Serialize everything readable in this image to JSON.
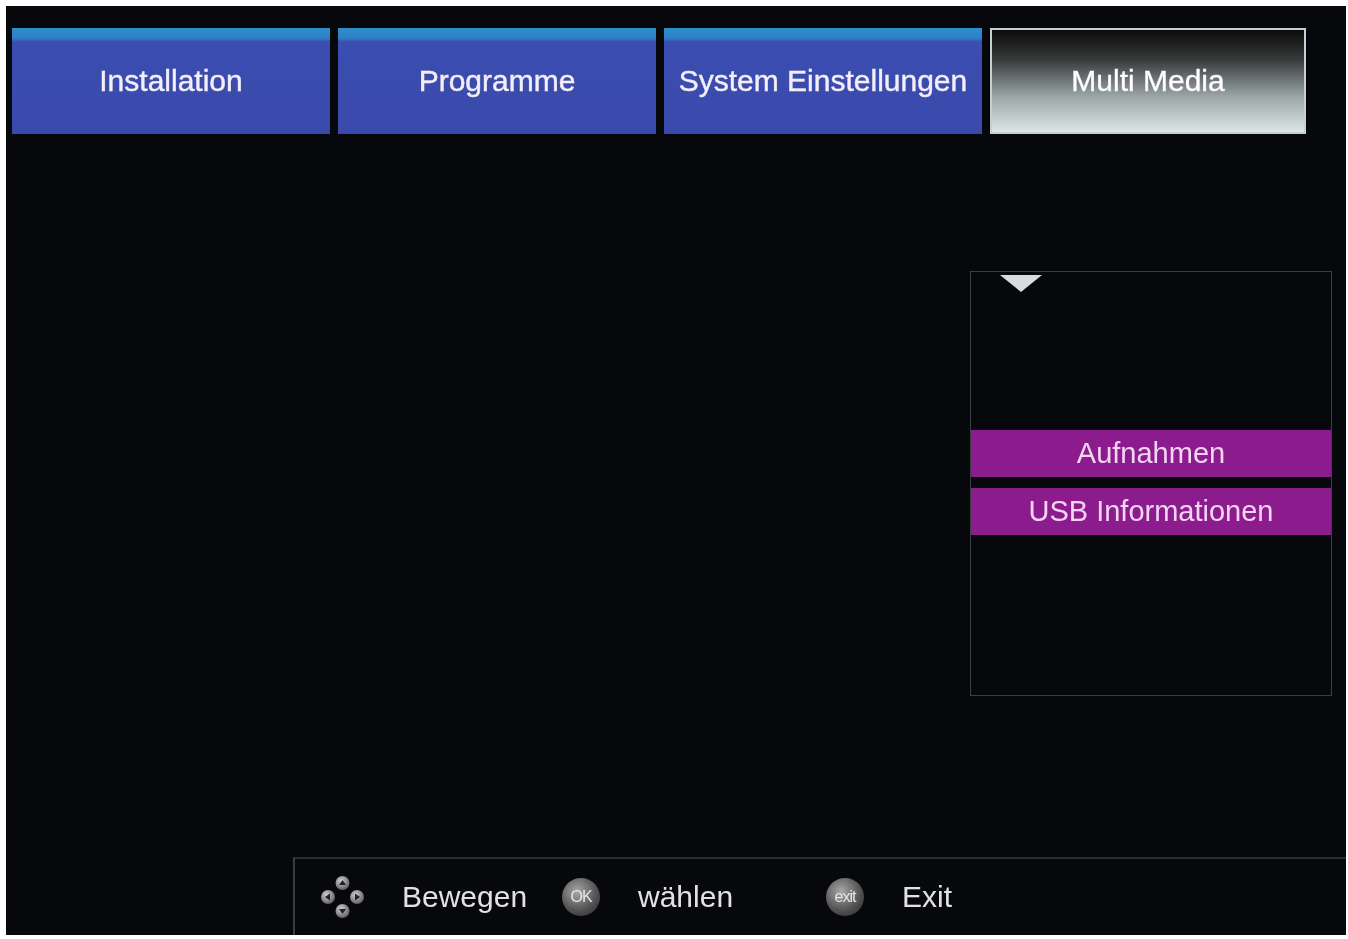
{
  "tabs": [
    {
      "label": "Installation",
      "selected": false
    },
    {
      "label": "Programme",
      "selected": false
    },
    {
      "label": "System Einstellungen",
      "selected": false
    },
    {
      "label": "Multi Media",
      "selected": true
    }
  ],
  "submenu": {
    "items": [
      {
        "label": "Aufnahmen"
      },
      {
        "label": "USB Informationen"
      }
    ]
  },
  "hint_bar": {
    "hints": [
      {
        "kind": "dpad",
        "label": "Bewegen"
      },
      {
        "kind": "key",
        "key": "OK",
        "label": "wählen"
      },
      {
        "kind": "key",
        "key": "exit",
        "label": "Exit"
      }
    ]
  }
}
